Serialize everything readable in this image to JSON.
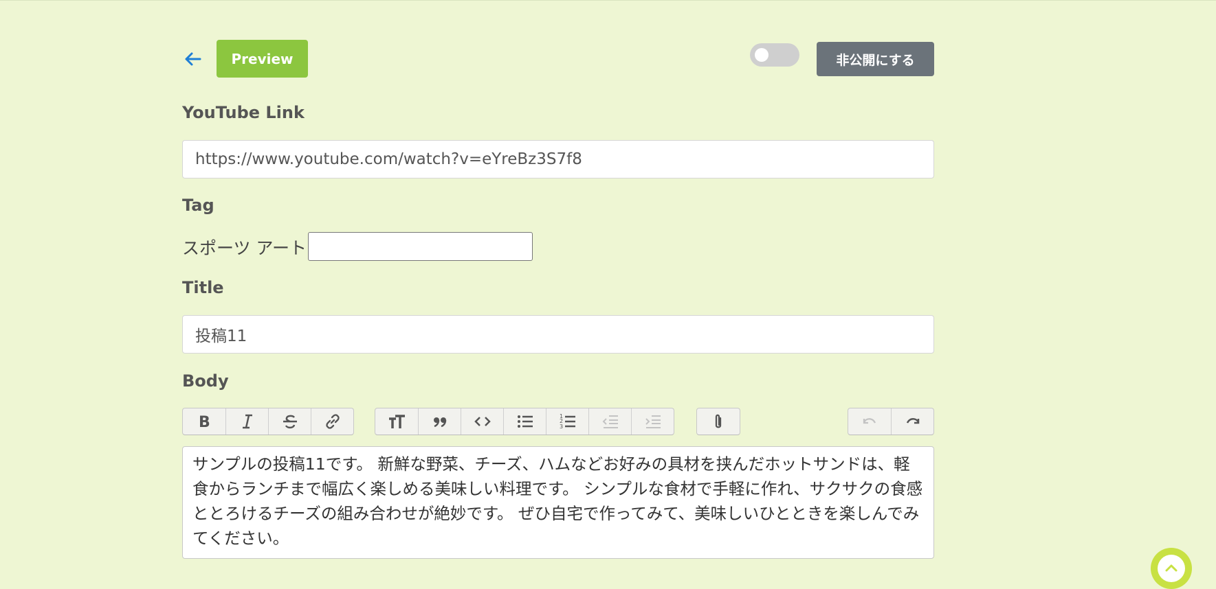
{
  "header": {
    "preview_label": "Preview",
    "private_label": "非公開にする",
    "publish_toggle_on": false
  },
  "youtube": {
    "label": "YouTube Link",
    "value": "https://www.youtube.com/watch?v=eYreBz3S7f8"
  },
  "tag": {
    "label": "Tag",
    "tags_text": "スポーツ アート",
    "input_value": ""
  },
  "title": {
    "label": "Title",
    "value": "投稿11"
  },
  "body": {
    "label": "Body",
    "text": "サンプルの投稿11です。 新鮮な野菜、チーズ、ハムなどお好みの具材を挟んだホットサンドは、軽食からランチまで幅広く楽しめる美味しい料理です。 シンプルな食材で手軽に作れ、サクサクの食感ととろけるチーズの組み合わせが絶妙です。 ぜひ自宅で作ってみて、美味しいひとときを楽しんでみてください。",
    "toolbar": {
      "text_tools": [
        "bold-icon",
        "italic-icon",
        "strikethrough-icon",
        "link-icon"
      ],
      "block_tools": [
        "heading-icon",
        "quote-icon",
        "code-icon",
        "bullet-list-icon",
        "number-list-icon",
        "outdent-icon",
        "indent-icon"
      ],
      "file_tools": [
        "attach-icon"
      ],
      "history_tools": [
        "undo-icon",
        "redo-icon"
      ]
    }
  },
  "colors": {
    "background": "#eef6d3",
    "preview_button": "#8cc63f",
    "private_button": "#6b737a",
    "back_arrow": "#1f7fd6",
    "scroll_top": "#c8e143"
  }
}
